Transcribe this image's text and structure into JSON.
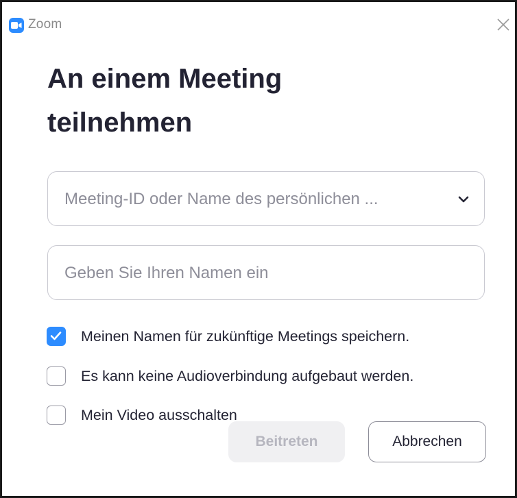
{
  "window": {
    "title": "Zoom",
    "brand_color": "#2d8cff",
    "logo_icon": "zoom-camera-icon",
    "close_icon": "close-icon"
  },
  "heading": "An einem Meeting teilnehmen",
  "meeting_field": {
    "placeholder": "Meeting-ID oder Name des persönlichen ...",
    "value": "",
    "dropdown_icon": "chevron-down-icon"
  },
  "name_field": {
    "placeholder": "Geben Sie Ihren Namen ein",
    "value": ""
  },
  "options": [
    {
      "label": "Meinen Namen für zukünftige Meetings speichern.",
      "checked": true
    },
    {
      "label": "Es kann keine Audioverbindung aufgebaut werden.",
      "checked": false
    },
    {
      "label": "Mein Video ausschalten",
      "checked": false
    }
  ],
  "buttons": {
    "join_label": "Beitreten",
    "join_enabled": false,
    "cancel_label": "Abbrechen"
  }
}
